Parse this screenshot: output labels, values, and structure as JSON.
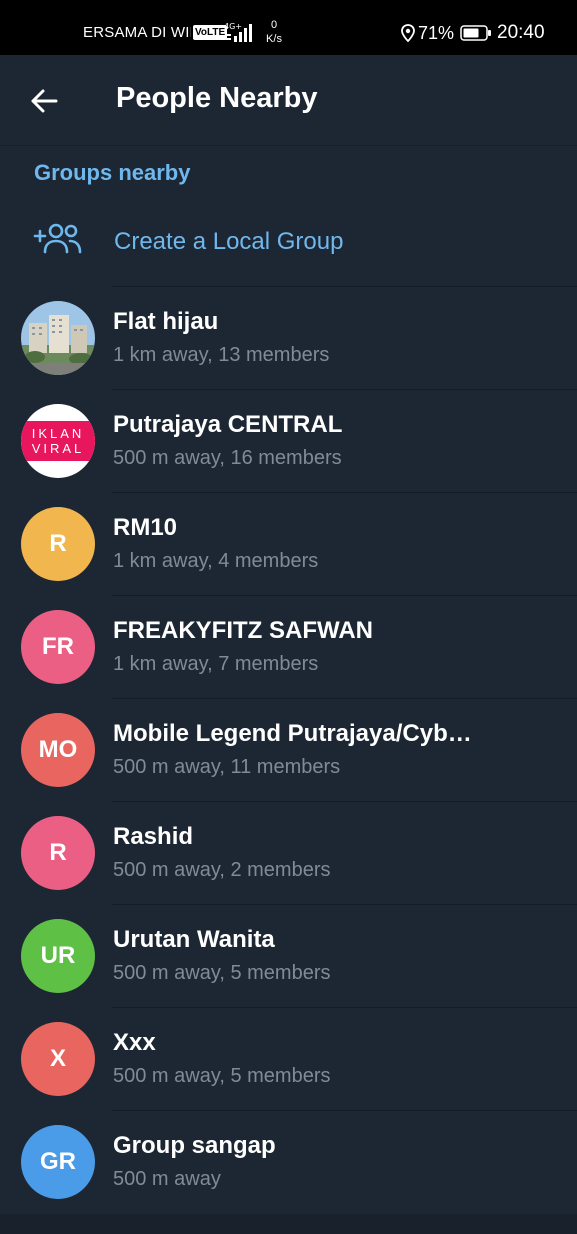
{
  "status_bar": {
    "carrier": "ERSAMA DI WILA",
    "volte": "VoLTE",
    "net_speed_value": "0",
    "net_speed_unit": "K/s",
    "battery_percent": "71%",
    "time": "20:40"
  },
  "header": {
    "title": "People Nearby"
  },
  "section": {
    "title": "Groups nearby"
  },
  "create": {
    "label": "Create a Local Group"
  },
  "colors": {
    "background": "#1d2733",
    "accent": "#6fb8ee",
    "secondary_text": "#7f8b97"
  },
  "groups": [
    {
      "name": "Flat hijau",
      "meta": "1 km away, 13 members",
      "avatar_type": "photo-building",
      "initials": ""
    },
    {
      "name": "Putrajaya CENTRAL",
      "meta": "500 m away, 16 members",
      "avatar_type": "iklan-viral",
      "initials": "",
      "avatar_text_1": "IKLAN",
      "avatar_text_2": "VIRAL"
    },
    {
      "name": "RM10",
      "meta": "1 km away, 4 members",
      "avatar_type": "initials",
      "initials": "R",
      "color": "#f2b64f"
    },
    {
      "name": "FREAKYFITZ SAFWAN",
      "meta": "1 km away, 7 members",
      "avatar_type": "initials",
      "initials": "FR",
      "color": "#ec5f84"
    },
    {
      "name": "Mobile Legend Putrajaya/Cyb…",
      "meta": "500 m away, 11 members",
      "avatar_type": "initials",
      "initials": "MO",
      "color": "#e8665f"
    },
    {
      "name": "Rashid",
      "meta": "500 m away, 2 members",
      "avatar_type": "initials",
      "initials": "R",
      "color": "#ec5f84"
    },
    {
      "name": "Urutan Wanita",
      "meta": "500 m away, 5 members",
      "avatar_type": "initials",
      "initials": "UR",
      "color": "#5ec146"
    },
    {
      "name": "Xxx",
      "meta": "500 m away, 5 members",
      "avatar_type": "initials",
      "initials": "X",
      "color": "#e8665f"
    },
    {
      "name": "Group sangap",
      "meta": "500 m away",
      "avatar_type": "initials",
      "initials": "GR",
      "color": "#4a9be8"
    }
  ]
}
